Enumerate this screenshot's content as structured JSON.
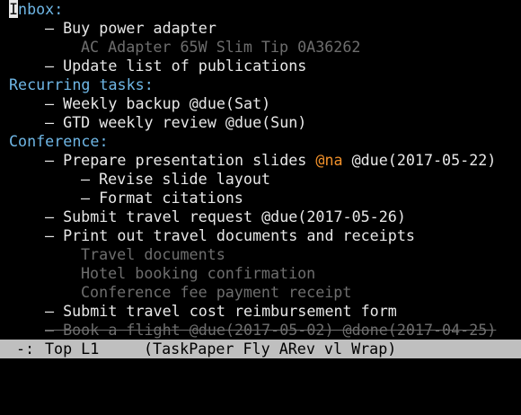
{
  "document": {
    "inbox": {
      "cursor_char": "I",
      "rest": "nbox:",
      "tasks": [
        {
          "label": "– Buy power adapter",
          "note": "AC Adapter 65W Slim Tip 0A36262"
        },
        {
          "label": "– Update list of publications"
        }
      ]
    },
    "recurring": {
      "label": "Recurring tasks:",
      "tasks": [
        {
          "label": "– Weekly backup @due(Sat)"
        },
        {
          "label": "– GTD weekly review @due(Sun)"
        }
      ]
    },
    "conference": {
      "label": "Conference:",
      "prepare": {
        "prefix": "– Prepare presentation slides ",
        "tag": "@na",
        "suffix": " @due(2017-05-22)",
        "subtasks": [
          "– Revise slide layout",
          "– Format citations"
        ]
      },
      "submit_request": "– Submit travel request @due(2017-05-26)",
      "print_docs": {
        "label": "– Print out travel documents and receipts",
        "notes": [
          "Travel documents",
          "Hotel booking confirmation",
          "Conference fee payment receipt"
        ]
      },
      "reimbursement": "– Submit travel cost reimbursement form",
      "book_flight": "– Book a flight @due(2017-05-02) @done(2017-04-25)"
    }
  },
  "modeline": {
    "status": "-:",
    "position": "Top L1",
    "modes": "(TaskPaper Fly ARev vl Wrap)"
  },
  "colors": {
    "project": "#6fb7e6",
    "note": "#6e6e6e",
    "tag_na": "#f0902a",
    "modeline_bg": "#bfbfbf"
  }
}
